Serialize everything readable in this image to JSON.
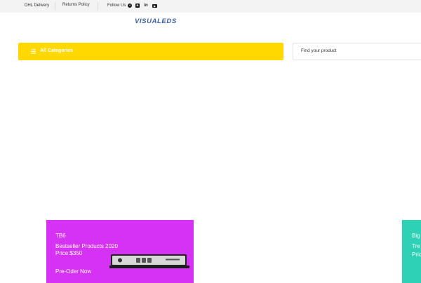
{
  "topbar": {
    "links": [
      "DHL Delivery",
      "Returns Policy"
    ],
    "follow_label": "Follow Us",
    "social_icons": [
      "facebook-icon",
      "blogger-icon",
      "linkedin-icon",
      "youtube-icon"
    ]
  },
  "logo": {
    "text": "VISUALEDS",
    "color": "#3b5fa8"
  },
  "categories_button": {
    "label": "All Categories",
    "color": "#ffd800"
  },
  "search": {
    "placeholder": "Find your product",
    "value": ""
  },
  "promo_main": {
    "model": "TB6",
    "headline": "Bestseller Products 2020",
    "price": "Price:$350",
    "cta": "Pre-Oder Now",
    "background": "#d532f5"
  },
  "promo_partial": {
    "line1": "Big",
    "line2": "Tre",
    "line3": "Pric",
    "background": "#2fd1b5"
  }
}
